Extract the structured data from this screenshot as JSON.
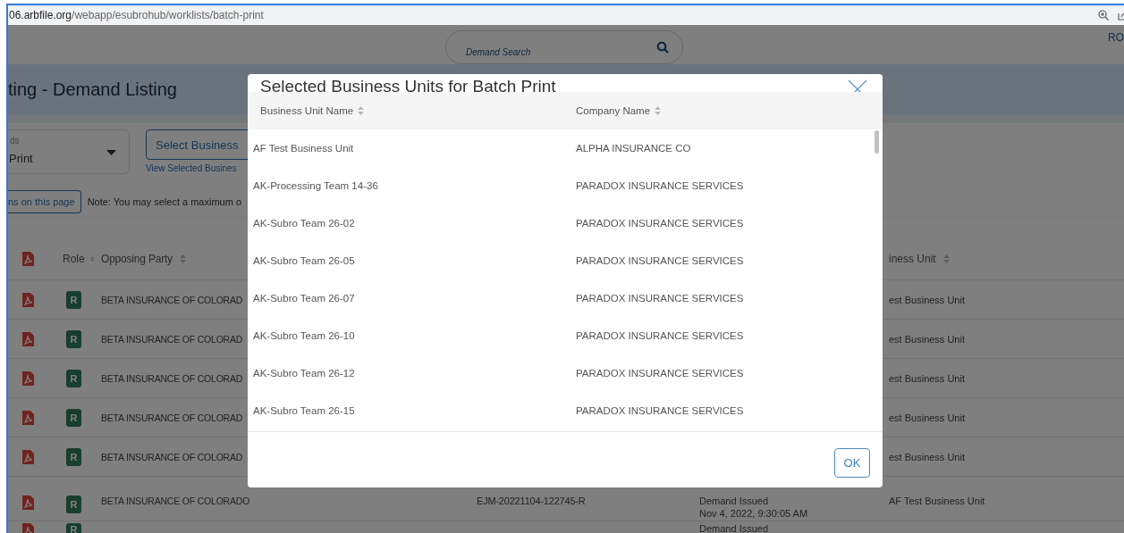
{
  "browser": {
    "url_host": "06.arbfile.org",
    "url_path": "/webapp/esubrohub/worklists/batch-print"
  },
  "header": {
    "search_placeholder": "Demand Search",
    "user": "RO"
  },
  "page_title": "ting - Demand Listing",
  "filter": {
    "label": "ds",
    "value": "Print"
  },
  "select_button": "Select Business",
  "view_link": "View Selected Busines",
  "page_button": "ns on this page",
  "note": "Note: You may select a maximum o",
  "table": {
    "columns": [
      {
        "label": "Role"
      },
      {
        "label": "Opposing Party"
      },
      {
        "label": "iness Unit"
      }
    ],
    "rows": [
      {
        "role": "R",
        "opposing_party": "BETA INSURANCE OF COLORAD",
        "business_unit": "est Business Unit"
      },
      {
        "role": "R",
        "opposing_party": "BETA INSURANCE OF COLORAD",
        "business_unit": "est Business Unit"
      },
      {
        "role": "R",
        "opposing_party": "BETA INSURANCE OF COLORAD",
        "business_unit": "est Business Unit"
      },
      {
        "role": "R",
        "opposing_party": "BETA INSURANCE OF COLORAD",
        "business_unit": "est Business Unit"
      },
      {
        "role": "R",
        "opposing_party": "BETA INSURANCE OF COLORAD",
        "business_unit": "est Business Unit"
      },
      {
        "role": "R",
        "opposing_party": "BETA INSURANCE OF COLORADO",
        "claim": "EJM-20221104-122745-R",
        "status": "Demand Issued",
        "status_date": "Nov 4, 2022, 9:30:05 AM",
        "business_unit": "AF Test Business Unit"
      },
      {
        "role": "R",
        "status": "Demand Issued"
      }
    ]
  },
  "modal": {
    "title": "Selected Business Units for Batch Print",
    "columns": [
      {
        "label": "Business Unit Name"
      },
      {
        "label": "Company Name"
      }
    ],
    "rows": [
      {
        "business_unit": "AF Test Business Unit",
        "company": "ALPHA INSURANCE CO"
      },
      {
        "business_unit": "AK-Processing Team 14-36",
        "company": "PARADOX INSURANCE SERVICES"
      },
      {
        "business_unit": "AK-Subro Team 26-02",
        "company": "PARADOX INSURANCE SERVICES"
      },
      {
        "business_unit": "AK-Subro Team 26-05",
        "company": "PARADOX INSURANCE SERVICES"
      },
      {
        "business_unit": "AK-Subro Team 26-07",
        "company": "PARADOX INSURANCE SERVICES"
      },
      {
        "business_unit": "AK-Subro Team 26-10",
        "company": "PARADOX INSURANCE SERVICES"
      },
      {
        "business_unit": "AK-Subro Team 26-12",
        "company": "PARADOX INSURANCE SERVICES"
      },
      {
        "business_unit": "AK-Subro Team 26-15",
        "company": "PARADOX INSURANCE SERVICES"
      }
    ],
    "ok_button": "OK"
  }
}
